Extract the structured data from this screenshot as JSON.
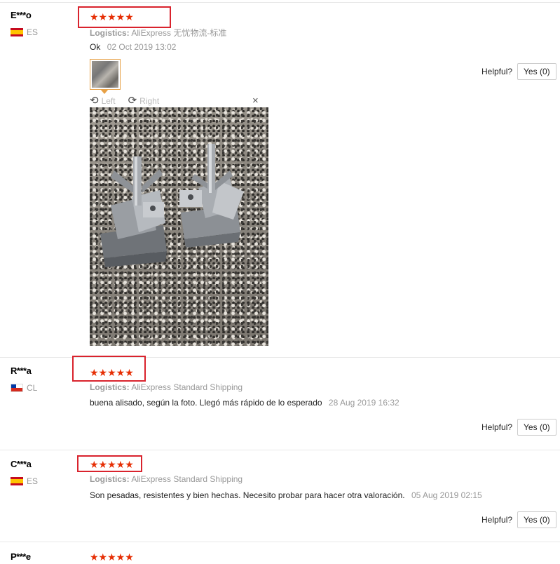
{
  "reviews": [
    {
      "user": "E***o",
      "country": "ES",
      "stars": "★★★★★",
      "logistics_label": "Logistics:",
      "logistics_value": "AliExpress 无忧物流-标准",
      "comment": "Ok",
      "date": "02 Oct 2019 13:02",
      "helpful_label": "Helpful?",
      "yes_label": "Yes (0)"
    },
    {
      "user": "R***a",
      "country": "CL",
      "stars": "★★★★★",
      "logistics_label": "Logistics:",
      "logistics_value": "AliExpress Standard Shipping",
      "comment": "buena alisado, según la foto. Llegó más rápido de lo esperado",
      "date": "28 Aug 2019 16:32",
      "helpful_label": "Helpful?",
      "yes_label": "Yes (0)"
    },
    {
      "user": "C***a",
      "country": "ES",
      "stars": "★★★★★",
      "logistics_label": "Logistics:",
      "logistics_value": "AliExpress Standard Shipping",
      "comment": "Son pesadas, resistentes y bien hechas. Necesito probar para hacer otra valoración.",
      "date": "05 Aug 2019 02:15",
      "helpful_label": "Helpful?",
      "yes_label": "Yes (0)"
    },
    {
      "user": "P***e",
      "stars": "★★★★★"
    }
  ],
  "viewer": {
    "rotate_left_icon": "rotate-left-icon",
    "left_label": "Left",
    "rotate_right_icon": "rotate-right-icon",
    "right_label": "Right",
    "close_icon": "×"
  },
  "colors": {
    "star": "#e62e04",
    "highlight_box": "#d9232d",
    "thumb_border": "#e7a146"
  }
}
